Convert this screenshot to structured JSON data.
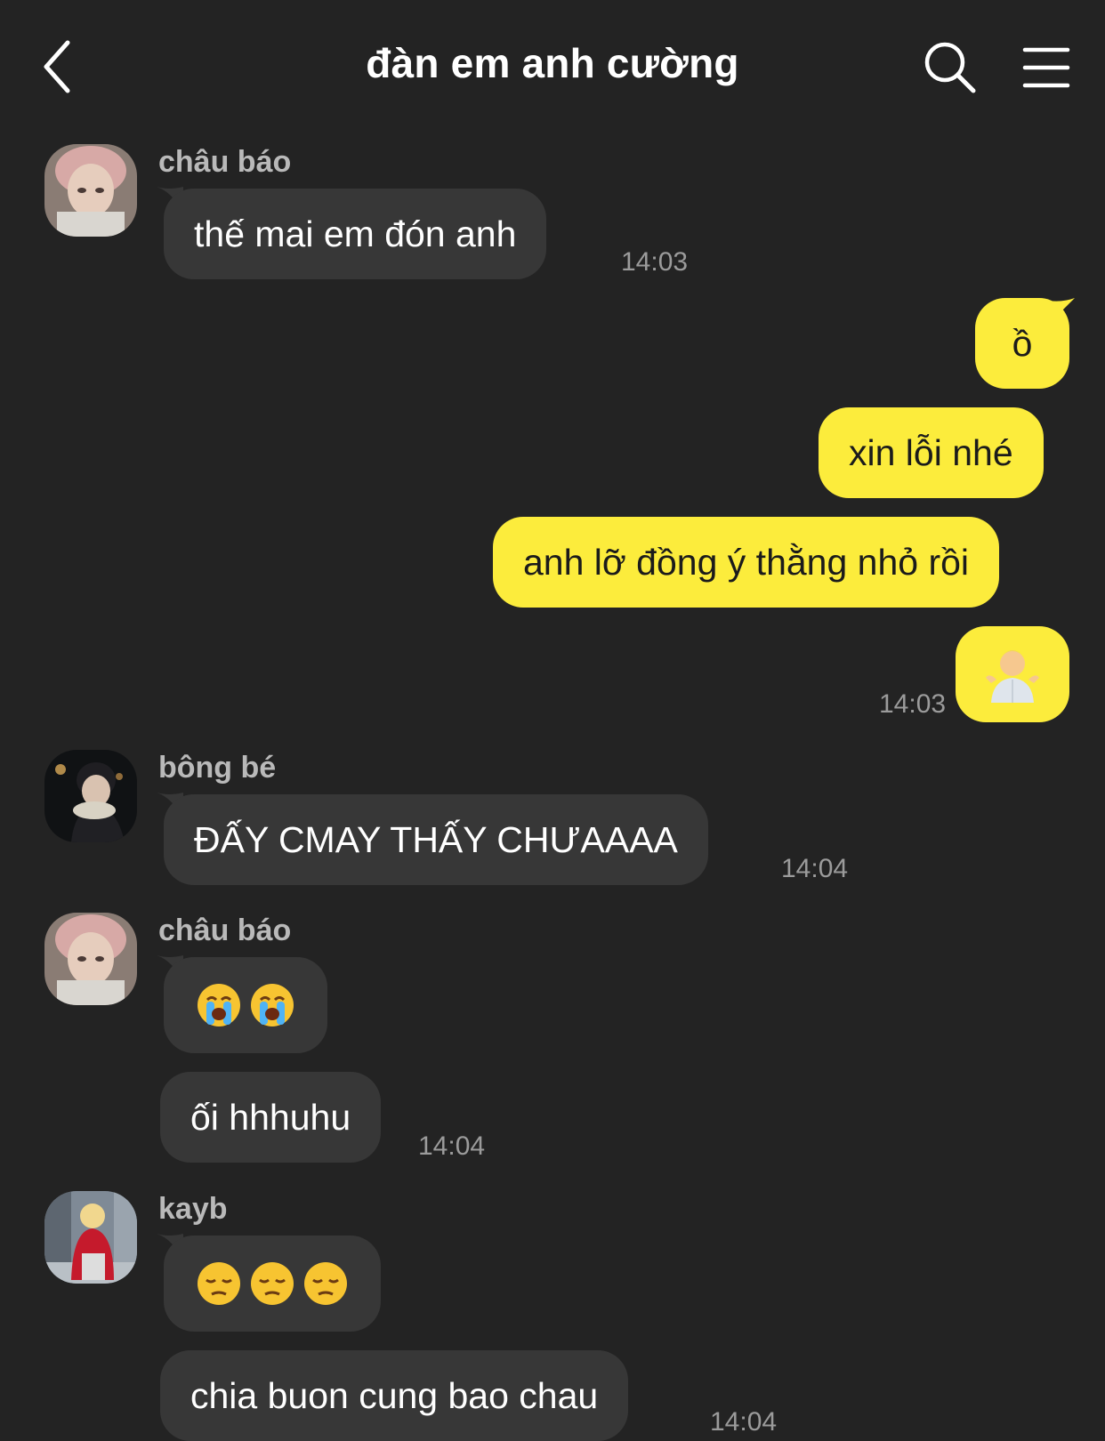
{
  "header": {
    "title": "đàn em anh cường"
  },
  "messages": [
    {
      "sender": "châu báo",
      "text": "thế mai em đón anh",
      "time": "14:03"
    },
    {
      "sender_self": true,
      "text_1": "ồ",
      "text_2": "xin lỗi nhé",
      "text_3": "anh lỡ đồng ý thằng nhỏ rồi",
      "emoji_4": "person-shrugging-emoji",
      "time": "14:03"
    },
    {
      "sender": "bông bé",
      "text": "ĐẤY CMAY THẤY CHƯAAAA",
      "time": "14:04"
    },
    {
      "sender": "châu báo",
      "emoji": "loudly-crying-face-emoji",
      "emoji_count": 2,
      "text": "ối hhhuhu",
      "time": "14:04"
    },
    {
      "sender": "kayb",
      "emoji": "pensive-face-emoji",
      "emoji_count": 3,
      "text": "chia buon cung bao chau",
      "time": "14:04"
    }
  ],
  "colors": {
    "background": "#232323",
    "incoming_bubble": "#373737",
    "outgoing_bubble": "#fcec3c",
    "timestamp": "#9b9b9b",
    "sender_name": "#b9b9b9"
  }
}
